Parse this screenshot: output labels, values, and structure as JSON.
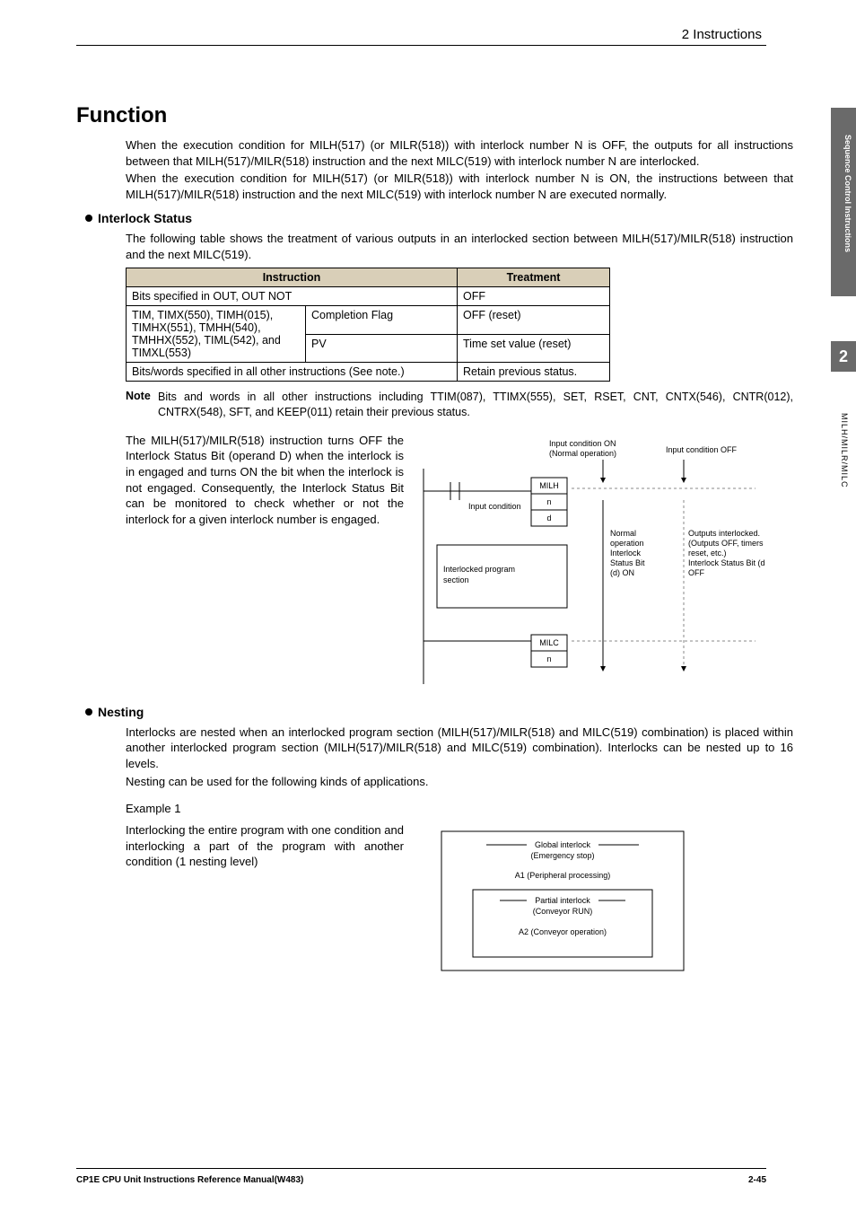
{
  "header": {
    "section": "2  Instructions"
  },
  "side": {
    "chapter": "2",
    "group": "Sequence Control Instructions",
    "page_label": "MILH/MILR/MILC"
  },
  "h1": "Function",
  "intro": {
    "p1": "When the execution condition for MILH(517) (or MILR(518)) with interlock number N is OFF, the outputs for all instructions between that MILH(517)/MILR(518) instruction and the next MILC(519) with interlock number N are interlocked.",
    "p2": "When the execution condition for MILH(517) (or MILR(518)) with interlock number N is ON, the instructions between that MILH(517)/MILR(518) instruction and the next MILC(519) with interlock number N are executed normally."
  },
  "s1": {
    "title": "Interlock Status",
    "desc": "The following table shows the treatment of various outputs in an interlocked section between MILH(517)/MILR(518) instruction and the next MILC(519).",
    "table": {
      "h1": "Instruction",
      "h2": "Treatment",
      "r1c1": "Bits specified in OUT, OUT NOT",
      "r1c2": "OFF",
      "r2c1a": "TIM, TIMX(550), TIMH(015), TIMHX(551), TMHH(540), TMHHX(552), TIML(542), and TIMXL(553)",
      "r2c1b": "Completion Flag",
      "r2c2": "OFF (reset)",
      "r3c1b": "PV",
      "r3c2": "Time set value (reset)",
      "r4c1": "Bits/words specified in all other instructions (See note.)",
      "r4c2": "Retain previous status."
    },
    "note_label": "Note",
    "note": "Bits and words in all other instructions including TTIM(087), TTIMX(555), SET, RSET, CNT, CNTX(546), CNTR(012), CNTRX(548), SFT, and KEEP(011) retain their previous status.",
    "para": "The MILH(517)/MILR(518) instruction turns OFF the Interlock Status Bit (operand D) when the interlock is in engaged and turns ON the bit when the interlock is not engaged. Consequently, the Interlock Status Bit can be monitored to check whether or not the interlock for a given interlock number is engaged.",
    "diag": {
      "cond_on": "Input condition ON",
      "cond_on2": "(Normal operation)",
      "cond_off": "Input condition OFF",
      "input_cond": "Input condition",
      "milh": "MILH",
      "n": "n",
      "d": "d",
      "section": "Interlocked program section",
      "milc": "MILC",
      "normal": "Normal operation Interlock Status Bit (d) ON",
      "outputs": "Outputs interlocked. (Outputs OFF, timers reset, etc.) Interlock Status Bit (d) OFF"
    }
  },
  "s2": {
    "title": "Nesting",
    "p1": "Interlocks are nested when an interlocked program section (MILH(517)/MILR(518) and MILC(519) combination) is placed within another interlocked program section (MILH(517)/MILR(518) and MILC(519) combination). Interlocks can be nested up to 16 levels.",
    "p2": "Nesting can be used for the following kinds of applications.",
    "ex_title": "Example 1",
    "ex_desc": "Interlocking the entire program with one condition and interlocking a part of the program with another condition (1 nesting level)",
    "diag": {
      "global": "Global interlock",
      "emerg": "(Emergency stop)",
      "a1": "A1 (Peripheral processing)",
      "partial": "Partial interlock",
      "conv": "(Conveyor RUN)",
      "a2": "A2 (Conveyor operation)"
    }
  },
  "footer": {
    "manual": "CP1E CPU Unit Instructions Reference Manual(W483)",
    "page": "2-45"
  }
}
